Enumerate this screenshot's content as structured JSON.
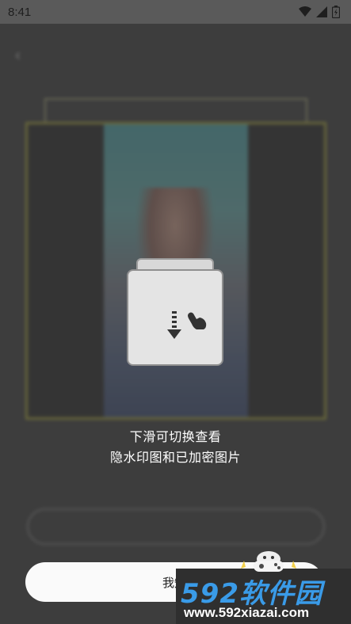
{
  "status_bar": {
    "time": "8:41"
  },
  "app": {
    "title": "",
    "blur_line_1": "",
    "blur_line_2": "",
    "blur_button_label": ""
  },
  "guide": {
    "line_1": "下滑可切换查看",
    "line_2": "隐水印图和已加密图片",
    "icon": "swipe-down-hand-icon"
  },
  "confirm_button_label": "我知",
  "watermark": {
    "brand": "592软件园",
    "url": "www.592xiazai.com"
  },
  "colors": {
    "frame_accent": "#8d8a3a",
    "watermark_blue": "#3a9be8"
  }
}
